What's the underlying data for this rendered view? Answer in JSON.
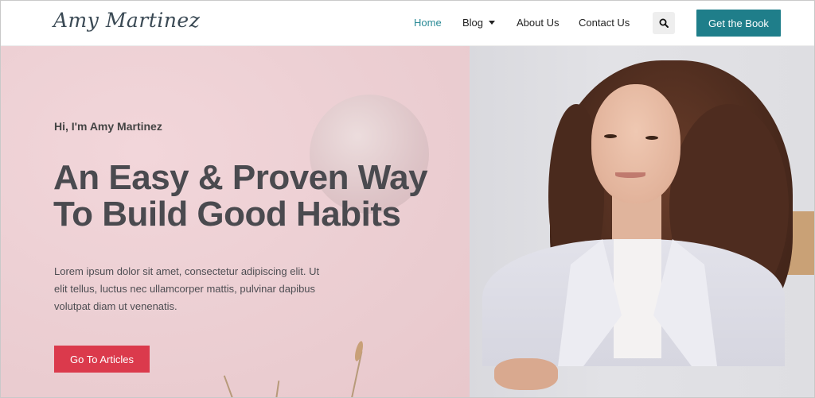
{
  "header": {
    "logo_text": "Amy Martinez",
    "nav": [
      {
        "label": "Home",
        "active": true
      },
      {
        "label": "Blog",
        "has_dropdown": true
      },
      {
        "label": "About Us"
      },
      {
        "label": "Contact Us"
      }
    ],
    "search_icon": "search-icon",
    "cta_label": "Get the Book"
  },
  "hero": {
    "greeting": "Hi, I'm Amy Martinez",
    "headline_lines": [
      "An Easy & Proven Way",
      "To Build Good Habits"
    ],
    "body_lines": [
      "Lorem ipsum dolor sit amet, consectetur adipiscing elit. Ut",
      "elit tellus, luctus nec ullamcorper mattis, pulvinar dapibus",
      "volutpat diam ut venenatis."
    ],
    "button_label": "Go To Articles"
  },
  "colors": {
    "accent": "#1f7e8a",
    "nav_active": "#2a8a96",
    "button_red": "#db3a4c",
    "hero_pink": "#ecd0d4"
  }
}
